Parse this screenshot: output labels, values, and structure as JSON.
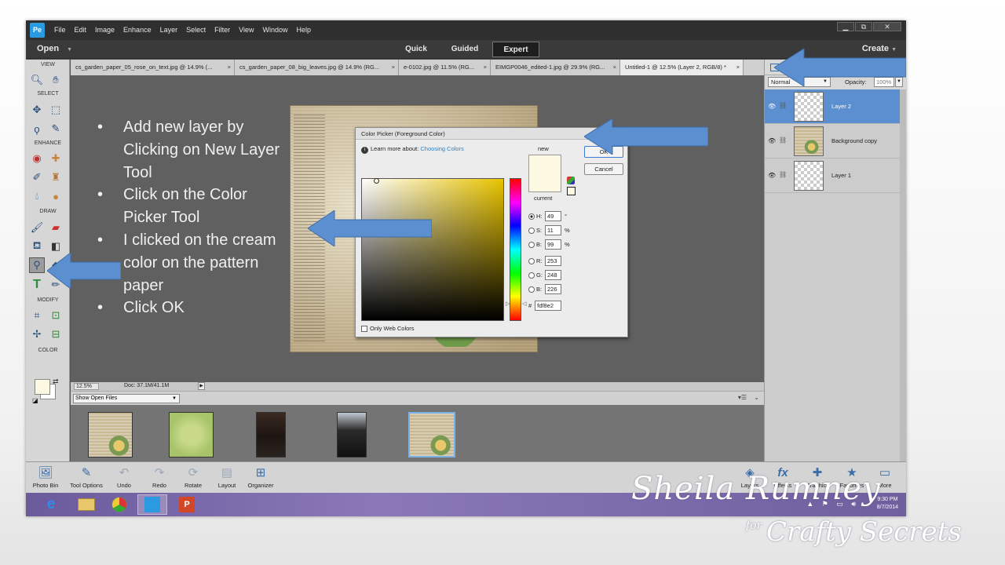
{
  "menubar": {
    "app_icon": "Pe",
    "items": [
      "File",
      "Edit",
      "Image",
      "Enhance",
      "Layer",
      "Select",
      "Filter",
      "View",
      "Window",
      "Help"
    ],
    "window_controls": [
      "▁",
      "⧉",
      "✕"
    ]
  },
  "modebar": {
    "open_label": "Open",
    "modes": [
      "Quick",
      "Guided",
      "Expert"
    ],
    "active_mode": "Expert",
    "create_label": "Create"
  },
  "tools": {
    "sections": [
      "VIEW",
      "SELECT",
      "ENHANCE",
      "DRAW",
      "MODIFY",
      "COLOR"
    ],
    "icons": [
      "zoom-icon",
      "hand-icon",
      "move-icon",
      "marquee-icon",
      "lasso-icon",
      "quick-selection-icon",
      "red-eye-icon",
      "spot-healing-icon",
      "smart-brush-icon",
      "clone-stamp-icon",
      "blur-icon",
      "sponge-icon",
      "brush-icon",
      "eraser-icon",
      "paint-bucket-icon",
      "gradient-icon",
      "eyedropper-icon",
      "shape-icon",
      "type-icon",
      "pencil-icon",
      "crop-icon",
      "recompose-icon",
      "content-aware-move-icon",
      "straighten-icon"
    ],
    "foreground_color": "#fdf8e2",
    "background_color": "#ffffff"
  },
  "tabs": [
    {
      "label": "cs_garden_paper_05_rose_on_text.jpg @ 14.9% (...",
      "active": false
    },
    {
      "label": "cs_garden_paper_08_big_leaves.jpg @ 14.9% (RG...",
      "active": false
    },
    {
      "label": "e-0102.jpg @ 11.5% (RG...",
      "active": false
    },
    {
      "label": "EIMGP0046_edited-1.jpg @ 29.9% (RG...",
      "active": false
    },
    {
      "label": "Untitled-1 @ 12.5% (Layer 2, RGB/8) *",
      "active": true
    }
  ],
  "tab_close": "×",
  "instructions": [
    "Add new layer by Clicking on New Layer Tool",
    "Click on the Color Picker Tool",
    "I clicked on the cream color on the pattern paper",
    "Click OK"
  ],
  "color_picker": {
    "title": "Color Picker (Foreground Color)",
    "close": "✕",
    "learn_prefix": "Learn more about:",
    "learn_link": "Choosing Colors",
    "new_label": "new",
    "current_label": "current",
    "new_color": "#fdf8e2",
    "current_color": "#fdf8e2",
    "ok_label": "OK",
    "cancel_label": "Cancel",
    "hsb": [
      {
        "label": "H:",
        "value": "49",
        "unit": "°",
        "selected": true
      },
      {
        "label": "S:",
        "value": "11",
        "unit": "%",
        "selected": false
      },
      {
        "label": "B:",
        "value": "99",
        "unit": "%",
        "selected": false
      }
    ],
    "rgb": [
      {
        "label": "R:",
        "value": "253"
      },
      {
        "label": "G:",
        "value": "248"
      },
      {
        "label": "B:",
        "value": "226"
      }
    ],
    "hex_label": "#",
    "hex_value": "fdf8e2",
    "web_only_label": "Only Web Colors"
  },
  "status": {
    "zoom": "12.5%",
    "doc_size": "Doc: 37.1M/41.1M"
  },
  "photo_bin": {
    "dropdown": "Show Open Files",
    "thumbnails": [
      "cs_garden_paper_05_rose_on_text",
      "cs_garden_paper_08_big_leaves",
      "e-0102",
      "EIMGP0046_edited-1",
      "Untitled-1"
    ]
  },
  "layers_panel": {
    "blend_mode": "Normal",
    "opacity_label": "Opacity:",
    "opacity_value": "100%",
    "layers": [
      {
        "name": "Layer 2",
        "selected": true
      },
      {
        "name": "Background copy",
        "selected": false
      },
      {
        "name": "Layer 1",
        "selected": false
      }
    ]
  },
  "app_bottom_bar": {
    "left": [
      "Photo Bin",
      "Tool Options",
      "Undo",
      "Redo",
      "Rotate",
      "Layout",
      "Organizer"
    ],
    "right": [
      "Layers",
      "Effects",
      "Graphics",
      "Favorites",
      "More"
    ]
  },
  "taskbar": {
    "time": "9:30 PM",
    "date": "8/7/2014"
  },
  "signature": {
    "name": "Sheila Rumney",
    "for": "for",
    "brand": "Crafty Secrets"
  },
  "colors": {
    "arrow": "#5b8fd0",
    "selection": "#5b8fd0",
    "accent": "#2b9ae0"
  }
}
